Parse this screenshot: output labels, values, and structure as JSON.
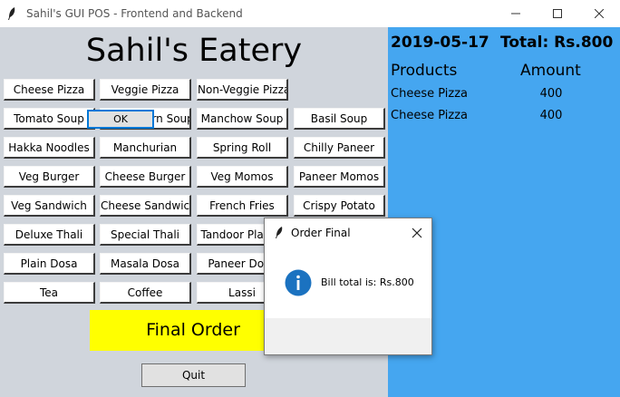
{
  "window": {
    "title": "Sahil's GUI POS - Frontend and Backend",
    "icons": {
      "app": "feather-icon",
      "minimize": "minimize-icon",
      "maximize": "maximize-icon",
      "close": "close-icon"
    }
  },
  "restaurant": {
    "name": "Sahil's Eatery"
  },
  "menu": [
    [
      "Cheese Pizza",
      "Veggie Pizza",
      "Non-Veggie Pizza",
      ""
    ],
    [
      "Tomato Soup",
      "Sweet Corn Soup",
      "Manchow Soup",
      "Basil Soup"
    ],
    [
      "Hakka Noodles",
      "Manchurian",
      "Spring Roll",
      "Chilly Paneer"
    ],
    [
      "Veg Burger",
      "Cheese Burger",
      "Veg Momos",
      "Paneer Momos"
    ],
    [
      "Veg Sandwich",
      "Cheese Sandwich",
      "French Fries",
      "Crispy Potato"
    ],
    [
      "Deluxe Thali",
      "Special Thali",
      "Tandoor Platter",
      ""
    ],
    [
      "Plain Dosa",
      "Masala Dosa",
      "Paneer Dosa",
      ""
    ],
    [
      "Tea",
      "Coffee",
      "Lassi",
      ""
    ]
  ],
  "actions": {
    "final_order": "Final Order",
    "quit": "Quit"
  },
  "bill": {
    "date": "2019-05-17",
    "total": "Total: Rs.800",
    "products_header": "Products",
    "amount_header": "Amount",
    "items": [
      {
        "product": "Cheese Pizza",
        "amount": "400"
      },
      {
        "product": "Cheese Pizza",
        "amount": "400"
      }
    ]
  },
  "dialog": {
    "title": "Order Final",
    "message": "Bill total is: Rs.800",
    "ok": "OK",
    "icon": "info-icon"
  },
  "colors": {
    "left_panel": "#d0d5dc",
    "right_panel": "#45a6f0",
    "final_order": "#ffff00",
    "ok_border": "#0078d7",
    "info_icon": "#1b72c0"
  }
}
